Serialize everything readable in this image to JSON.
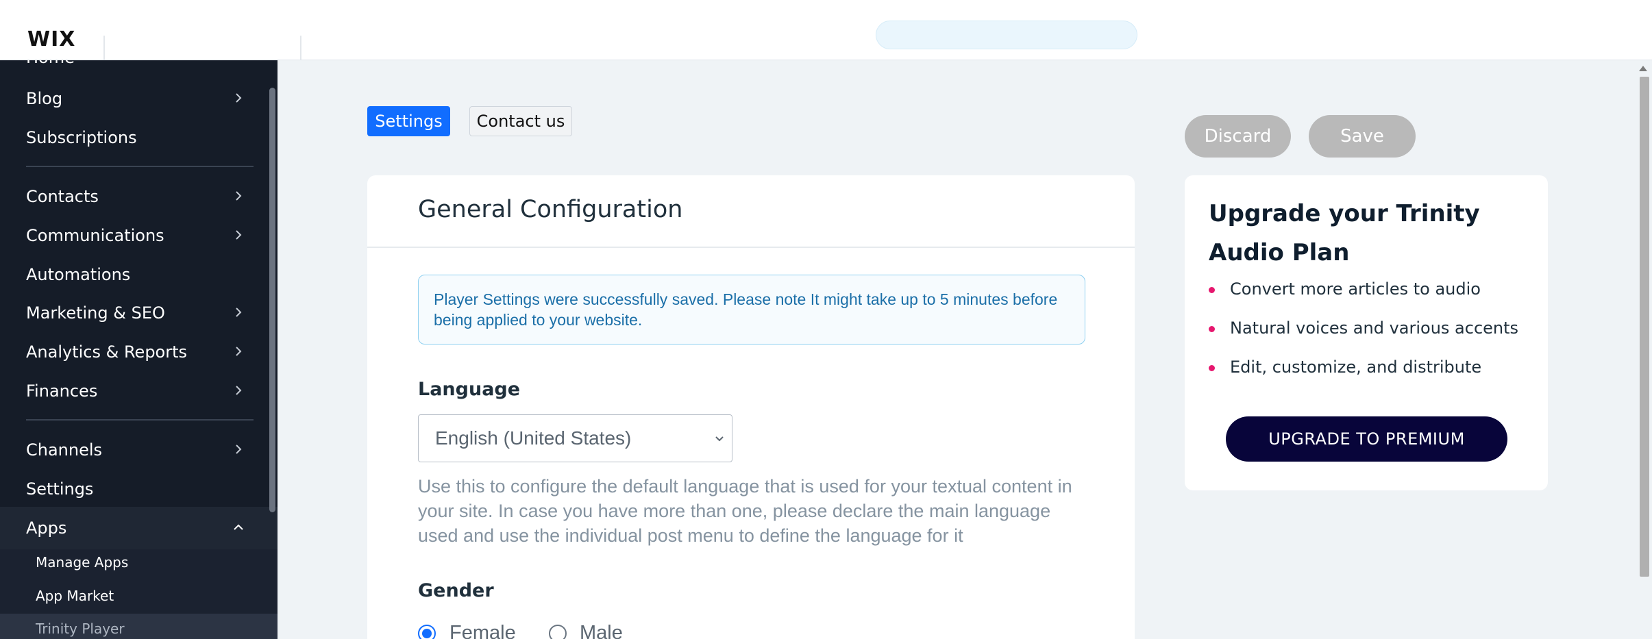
{
  "topbar": {
    "logo": "WIX"
  },
  "sidebar": {
    "items": [
      {
        "label": "Home",
        "chevron": false
      },
      {
        "label": "Blog",
        "chevron": true
      },
      {
        "label": "Subscriptions",
        "chevron": false
      },
      {
        "label": "Contacts",
        "chevron": true
      },
      {
        "label": "Communications",
        "chevron": true
      },
      {
        "label": "Automations",
        "chevron": false
      },
      {
        "label": "Marketing & SEO",
        "chevron": true
      },
      {
        "label": "Analytics & Reports",
        "chevron": true
      },
      {
        "label": "Finances",
        "chevron": true
      },
      {
        "label": "Channels",
        "chevron": true
      },
      {
        "label": "Settings",
        "chevron": false
      },
      {
        "label": "Apps",
        "chevron": true,
        "expanded": true
      }
    ],
    "sub_items": [
      "Manage Apps",
      "App Market",
      "Trinity Player"
    ]
  },
  "tabs": {
    "settings": "Settings",
    "contact": "Contact us"
  },
  "actions": {
    "discard": "Discard",
    "save": "Save"
  },
  "card": {
    "title": "General Configuration",
    "notice": "Player Settings were successfully saved. Please note It might take up to 5 minutes before being applied to your website.",
    "language_label": "Language",
    "language_value": "English (United States)",
    "language_help": "Use this to configure the default language that is used for your textual content in your site. In case you have more than one, please declare the main language used and use the individual post menu to define the language for it",
    "gender_label": "Gender",
    "gender_options": [
      "Female",
      "Male"
    ],
    "gender_selected": "Female"
  },
  "upgrade": {
    "title": "Upgrade your Trinity Audio Plan",
    "bullets": [
      "Convert more articles to audio",
      "Natural voices and various accents",
      "Edit, customize, and distribute"
    ],
    "button": "UPGRADE TO PREMIUM"
  },
  "colors": {
    "accent": "#116dff",
    "sidebar_bg": "#151c28",
    "bullet": "#e6176e",
    "upgrade_button": "#08053a"
  }
}
